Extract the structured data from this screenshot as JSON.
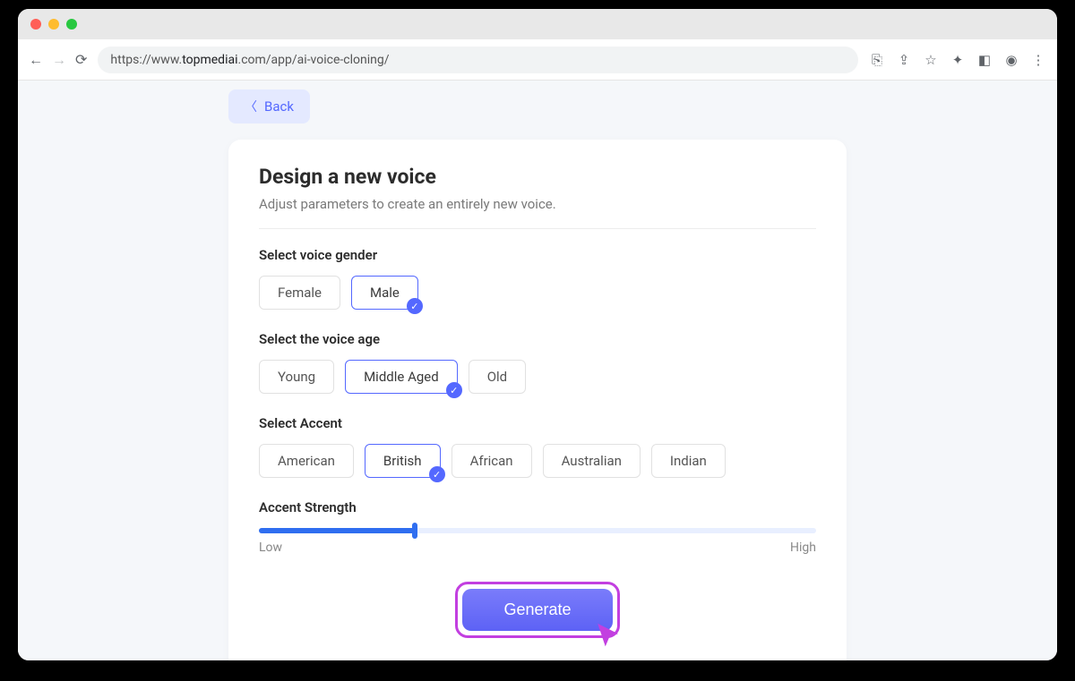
{
  "browser": {
    "url_prefix": "https://www.",
    "url_domain": "topmediai",
    "url_suffix": ".com/app/ai-voice-cloning/"
  },
  "back_button": {
    "label": "Back"
  },
  "page": {
    "title": "Design a new voice",
    "subtitle": "Adjust parameters to create an entirely new voice."
  },
  "gender": {
    "label": "Select voice gender",
    "options": [
      "Female",
      "Male"
    ],
    "selected": "Male"
  },
  "age": {
    "label": "Select the voice age",
    "options": [
      "Young",
      "Middle Aged",
      "Old"
    ],
    "selected": "Middle Aged"
  },
  "accent": {
    "label": "Select Accent",
    "options": [
      "American",
      "British",
      "African",
      "Australian",
      "Indian"
    ],
    "selected": "British"
  },
  "strength": {
    "label": "Accent Strength",
    "low_label": "Low",
    "high_label": "High",
    "value_percent": 28
  },
  "generate": {
    "label": "Generate"
  }
}
